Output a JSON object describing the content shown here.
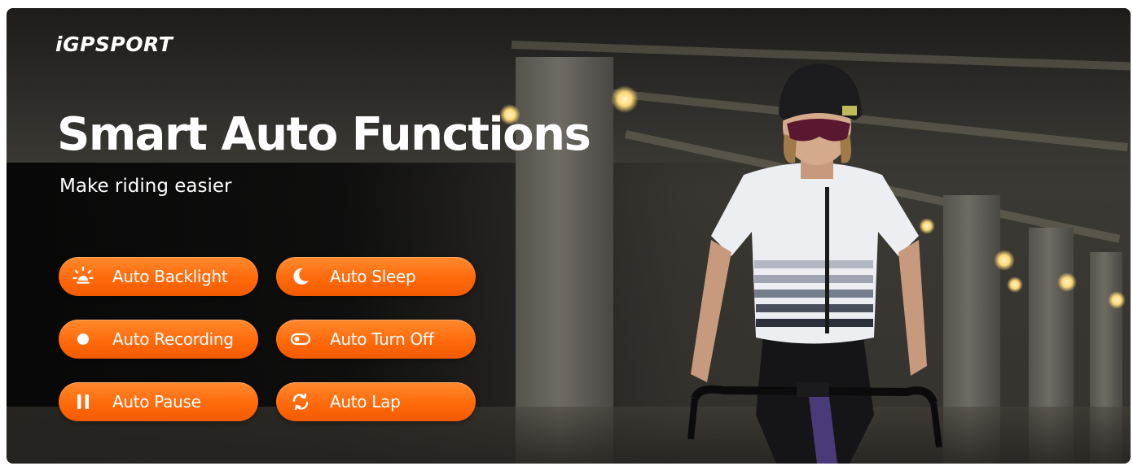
{
  "brand": {
    "logo_text": "iGPSPORT"
  },
  "hero": {
    "title": "Smart Auto Functions",
    "subtitle": "Make riding easier"
  },
  "features": [
    {
      "label": "Auto Backlight",
      "icon": "sun-icon"
    },
    {
      "label": "Auto Sleep",
      "icon": "moon-icon"
    },
    {
      "label": "Auto Recording",
      "icon": "record-dot-icon"
    },
    {
      "label": "Auto Turn Off",
      "icon": "toggle-off-icon"
    },
    {
      "label": "Auto Pause",
      "icon": "pause-icon"
    },
    {
      "label": "Auto Lap",
      "icon": "loop-arrows-icon"
    }
  ],
  "colors": {
    "accent": "#ff6a0b",
    "accent_light": "#ff8a2e",
    "text": "#ffffff",
    "background_dark": "#0a0a0a"
  }
}
